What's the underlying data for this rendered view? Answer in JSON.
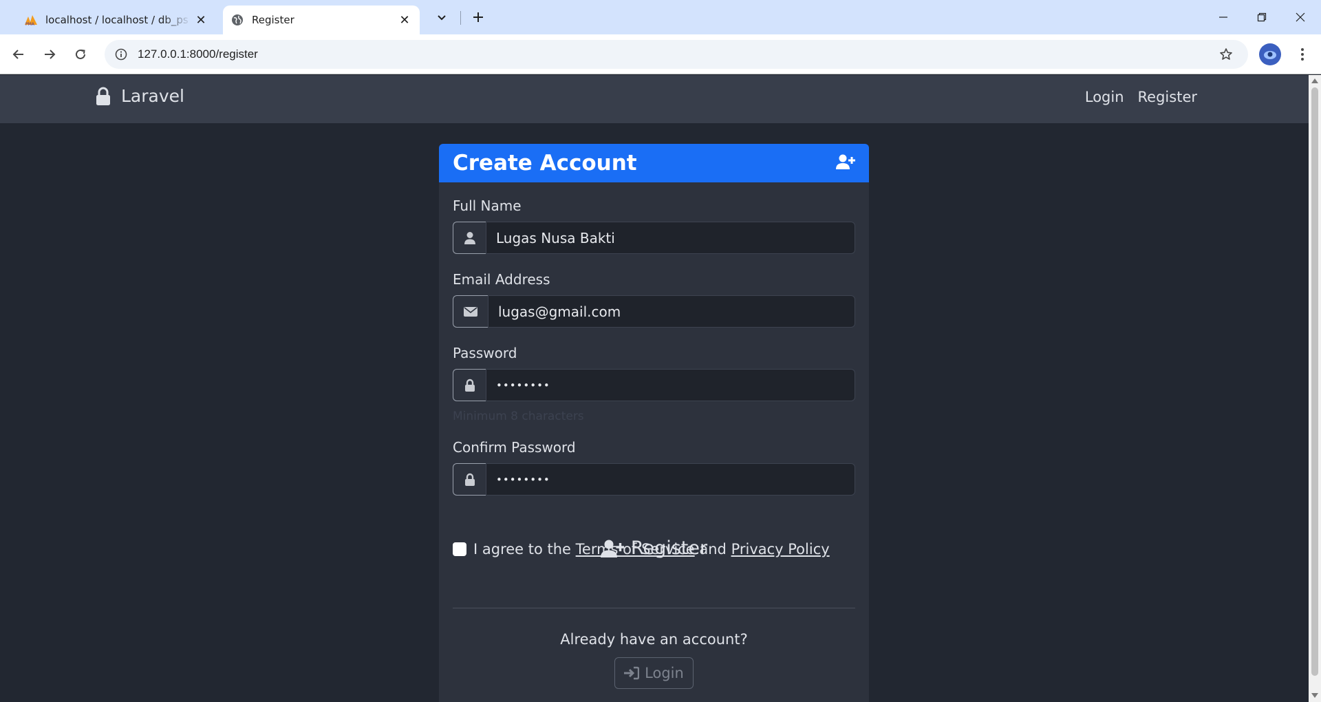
{
  "browser": {
    "tabs": [
      {
        "title": "localhost / localhost / db_ps / u",
        "favicon": "phpmyadmin-icon",
        "active": false
      },
      {
        "title": "Register",
        "favicon": "globe-icon",
        "active": true
      }
    ],
    "url": "127.0.0.1:8000/register"
  },
  "app": {
    "brand": "Laravel",
    "nav": {
      "login": "Login",
      "register": "Register"
    }
  },
  "form": {
    "title": "Create Account",
    "full_name": {
      "label": "Full Name",
      "value": "Lugas Nusa Bakti",
      "icon": "user-icon"
    },
    "email": {
      "label": "Email Address",
      "value": "lugas@gmail.com",
      "icon": "envelope-icon"
    },
    "password": {
      "label": "Password",
      "value": "••••••••",
      "hint": "Minimum 8 characters",
      "icon": "lock-icon"
    },
    "confirm_password": {
      "label": "Confirm Password",
      "value": "••••••••",
      "icon": "lock-icon"
    },
    "agree": {
      "prefix": "I agree to the ",
      "terms": "Terms of Service",
      "and": " and ",
      "privacy": "Privacy Policy",
      "checked": false
    },
    "submit": "Register",
    "already": "Already have an account?",
    "login": "Login"
  },
  "colors": {
    "accent": "#1a6ef5",
    "navbar": "#383e4b",
    "background": "#222731",
    "card": "#2d323d"
  }
}
